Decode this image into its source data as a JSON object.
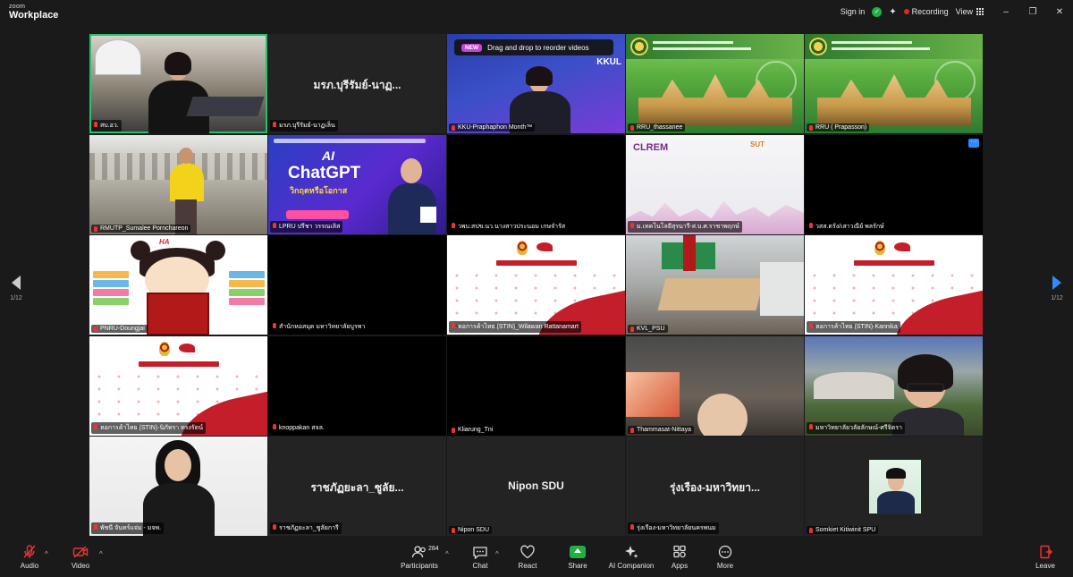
{
  "app": {
    "brand_top": "zoom",
    "brand_main": "Workplace"
  },
  "top_bar": {
    "sign_in": "Sign in",
    "recording": "Recording",
    "view": "View"
  },
  "pager": {
    "left": "1/12",
    "right": "1/12"
  },
  "banner": {
    "badge": "NEW",
    "text": "Drag and drop to reorder videos"
  },
  "tiles": [
    {
      "label": "สบ.อว."
    },
    {
      "label": "มรภ.บุรีรัมย์-นาฏเล็น",
      "center": "มรภ.บุรีรัมย์-นาฏ..."
    },
    {
      "label": "KKU-Praphaphon Month™",
      "overlay": "KKUL"
    },
    {
      "label": "RRU_thassanee"
    },
    {
      "label": "RRU ( Prapasson)"
    },
    {
      "label": "RMUTP_Sumalee Pornchareon"
    },
    {
      "label": "LPRU ปรีชา วรรณเลิส",
      "ai": "AI",
      "title": "ChatGPT",
      "sub": "วิกฤตหรือโอกาส"
    },
    {
      "label": "วพบ.สปข.นว.นางสาวประนอม เกษจำรัส"
    },
    {
      "label": "ม.เทคโนโลยีสุรนารี-ส.บ.ศ.ราชาพฤกษ์",
      "logo": "CLREM",
      "logo2": "SUT"
    },
    {
      "label": "วสส.ตรัง/เสาวณีย์ พลรักษ์"
    },
    {
      "label": "PNRU-Doungjai",
      "ha": "HA"
    },
    {
      "label": "สำนักหอสมุด มหาวิทยาลัยบูรพา"
    },
    {
      "label": "หอการค้าไทย (STIN)_Wilawan Rattanamart"
    },
    {
      "label": "KVL_PSU"
    },
    {
      "label": "หอการค้าไทย (STIN)-Kannika"
    },
    {
      "label": "หอการค้าไทย (STIN)-นิภัทรา ทรงรัตน์"
    },
    {
      "label": "knoppakan สจล."
    },
    {
      "label": "Kliarung_Tni"
    },
    {
      "label": "Thammasat-Nittaya"
    },
    {
      "label": "มหาวิทยาลัยวลัยลักษณ์-ศรีจิตรา"
    },
    {
      "label": "พัชนี จันทร์แจ่ม - มจพ."
    },
    {
      "label": "ราชภัฏยะลา_ซูลัยการี",
      "center": "ราชภัฏยะลา_ซูลัย..."
    },
    {
      "label": "Nipon SDU",
      "center": "Nipon SDU"
    },
    {
      "label": "รุ่งเรือง-มหาวิทยาลัยนครพนม",
      "center": "รุ่งเรือง-มหาวิทยา..."
    },
    {
      "label": "Somkiet Kitiwinit SPU"
    }
  ],
  "toolbar": {
    "audio": "Audio",
    "video": "Video",
    "participants": "Participants",
    "participants_count": "284",
    "chat": "Chat",
    "react": "React",
    "share": "Share",
    "ai_companion": "AI Companion",
    "apps": "Apps",
    "more": "More",
    "leave": "Leave"
  },
  "colors": {
    "active_outline": "#25c16f",
    "share_green": "#1fb141",
    "accent_blue": "#2d8cff",
    "record_red": "#e02828"
  }
}
